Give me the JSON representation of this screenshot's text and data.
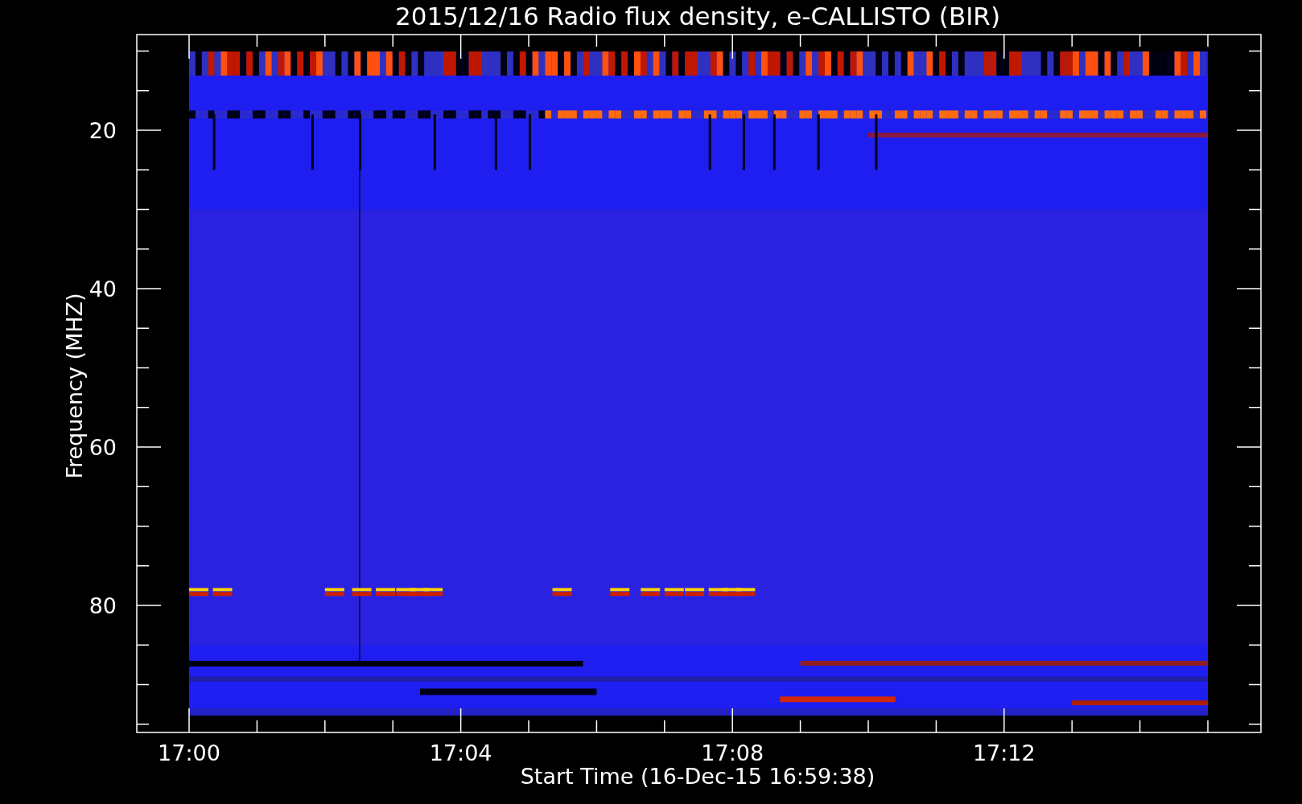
{
  "title": "2015/12/16  Radio flux density, e-CALLISTO (BIR)",
  "plot": {
    "ylabel": "Frequency (MHZ)",
    "xlabel": "Start Time (16-Dec-15 16:59:38)",
    "yticks": [
      "20",
      "40",
      "60",
      "80"
    ],
    "xticks": [
      "17:00",
      "17:04",
      "17:08",
      "17:12"
    ]
  }
}
